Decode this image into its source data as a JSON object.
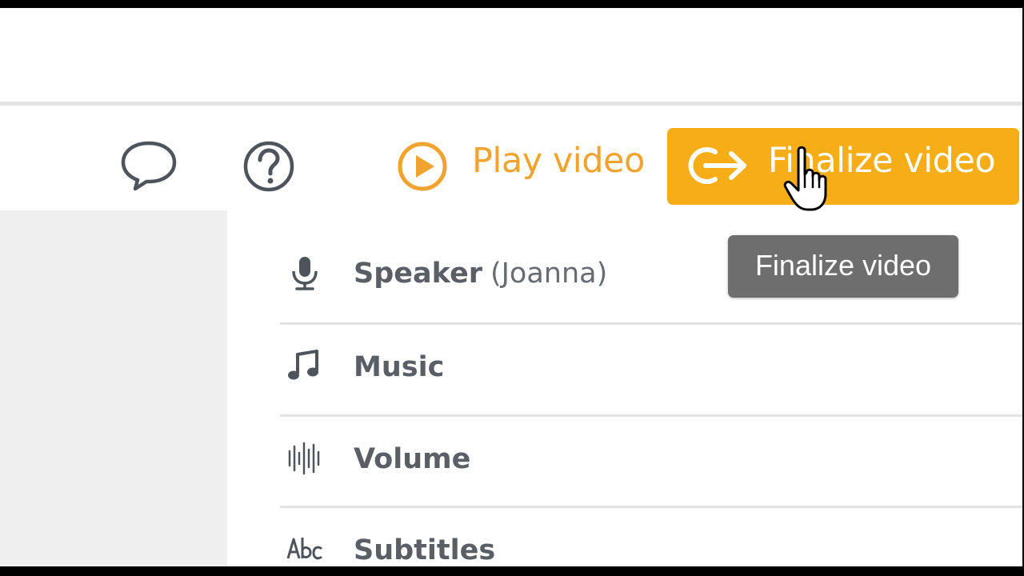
{
  "toolbar": {
    "chat_icon": "chat-bubble-icon",
    "help_icon": "question-circle-icon",
    "play_label": "Play video",
    "play_icon": "play-circle-icon",
    "finalize_label": "Finalize video",
    "finalize_icon": "export-arrow-icon",
    "accent_color": "#f6ad16",
    "play_color": "#f1a330"
  },
  "tooltip": {
    "text": "Finalize video"
  },
  "settings": {
    "items": [
      {
        "icon": "microphone-icon",
        "label": "Speaker",
        "sub": "(Joanna)"
      },
      {
        "icon": "music-note-icon",
        "label": "Music"
      },
      {
        "icon": "waveform-icon",
        "label": "Volume"
      },
      {
        "icon": "abc-text-icon",
        "label": "Subtitles"
      }
    ]
  },
  "cursor": "hand-pointer-icon"
}
